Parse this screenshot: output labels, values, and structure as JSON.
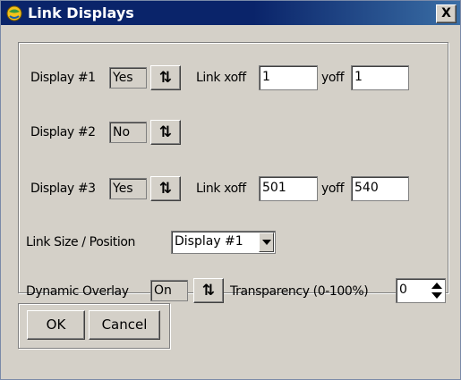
{
  "window": {
    "title": "Link Displays",
    "close_label": "X"
  },
  "display1": {
    "label": "Display #1",
    "value": "Yes",
    "xoff_label": "Link xoff",
    "xoff": "1",
    "yoff_label": "yoff",
    "yoff": "1"
  },
  "display2": {
    "label": "Display #2",
    "value": "No"
  },
  "display3": {
    "label": "Display #3",
    "value": "Yes",
    "xoff_label": "Link xoff",
    "xoff": "501",
    "yoff_label": "yoff",
    "yoff": "540"
  },
  "link_size": {
    "label": "Link Size / Position",
    "selected": "Display #1"
  },
  "overlay": {
    "label": "Dynamic Overlay",
    "value": "On",
    "transparency_label": "Transparency (0-100%)",
    "transparency": "0"
  },
  "buttons": {
    "ok": "OK",
    "cancel": "Cancel"
  },
  "icons": {
    "title": "globe-icon",
    "swap": "swap-arrows-icon",
    "dropdown": "chevron-down-icon",
    "spinner": "spinner-arrows-icon"
  }
}
